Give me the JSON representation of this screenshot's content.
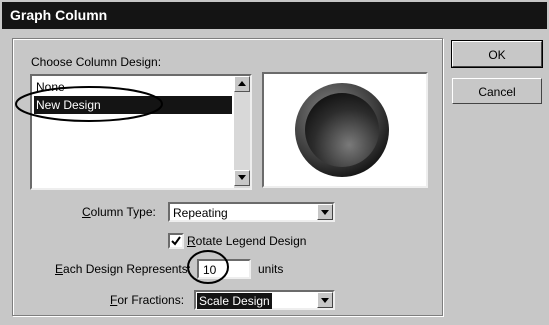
{
  "window": {
    "title": "Graph Column"
  },
  "group": {
    "label": "Choose Column Design:"
  },
  "designs": [
    {
      "label": "None",
      "selected": false
    },
    {
      "label": "New Design",
      "selected": true
    }
  ],
  "preview": {
    "shape": "dark-disc-icon"
  },
  "buttons": {
    "ok": "OK",
    "cancel": "Cancel"
  },
  "column_type": {
    "label_ul": "C",
    "label_rest": "olumn Type:",
    "value": "Repeating"
  },
  "rotate_legend": {
    "label_ul": "R",
    "label_rest": "otate Legend Design",
    "checked": true
  },
  "each_design": {
    "label_ul": "E",
    "label_rest": "ach Design Represents:",
    "value": "10",
    "units": "units"
  },
  "fractions": {
    "label_ul": "F",
    "label_rest": "or Fractions:",
    "value": "Scale Design"
  },
  "colors": {
    "titlebar": "#141414",
    "dialog": "#c7c7c7",
    "selection": "#141414"
  }
}
